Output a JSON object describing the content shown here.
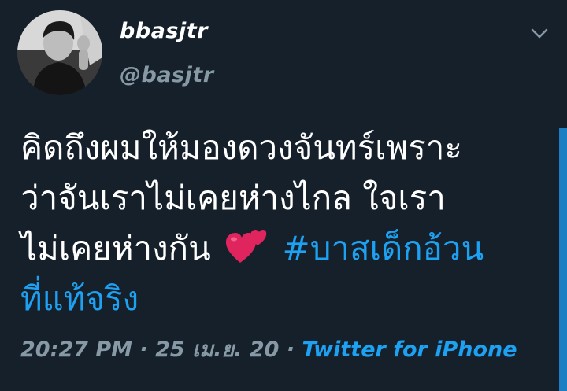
{
  "tweet": {
    "display_name": "bbasjtr",
    "handle": "@basjtr",
    "text_line1": "คิดถึงผมให้มองดวงจันทร์เพราะ",
    "text_line2": "ว่าจันเราไม่เคยห่างไกล ใจเรา",
    "text_line3": "ไม่เคยห่างกัน",
    "hashtag_part1": "#บาสเด็กอ้วน",
    "hashtag_part2": "ที่แท้จริง",
    "emoji": "two-hearts",
    "time": "20:27 PM",
    "date": "25 เม.ย. 20",
    "source": "Twitter for iPhone",
    "separator": "·"
  }
}
